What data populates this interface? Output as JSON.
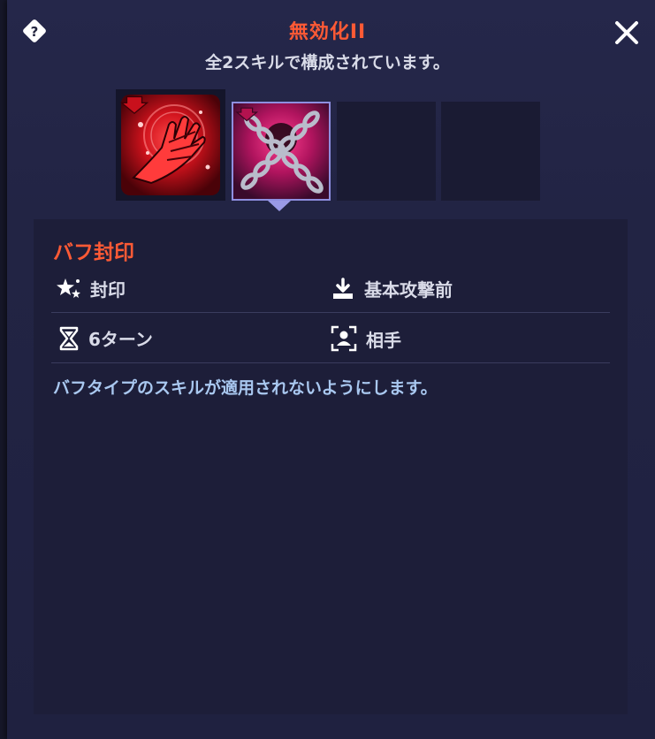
{
  "dialog": {
    "title": "無効化II",
    "subtitle": "全2スキルで構成されています。"
  },
  "skill_slots": [
    {
      "icon": "red-hand-debuff-icon",
      "selected": false
    },
    {
      "icon": "chain-seal-debuff-icon",
      "selected": true
    },
    {
      "icon": "empty-slot",
      "selected": false
    },
    {
      "icon": "empty-slot",
      "selected": false
    }
  ],
  "detail": {
    "name": "バフ封印",
    "type_label": "封印",
    "timing_label": "基本攻撃前",
    "duration_label": "6ターン",
    "target_label": "相手",
    "description": "バフタイプのスキルが適用されないようにします。"
  },
  "colors": {
    "accent": "#ff5a35",
    "description": "#a9c8f0",
    "text": "#d9dbe8"
  }
}
